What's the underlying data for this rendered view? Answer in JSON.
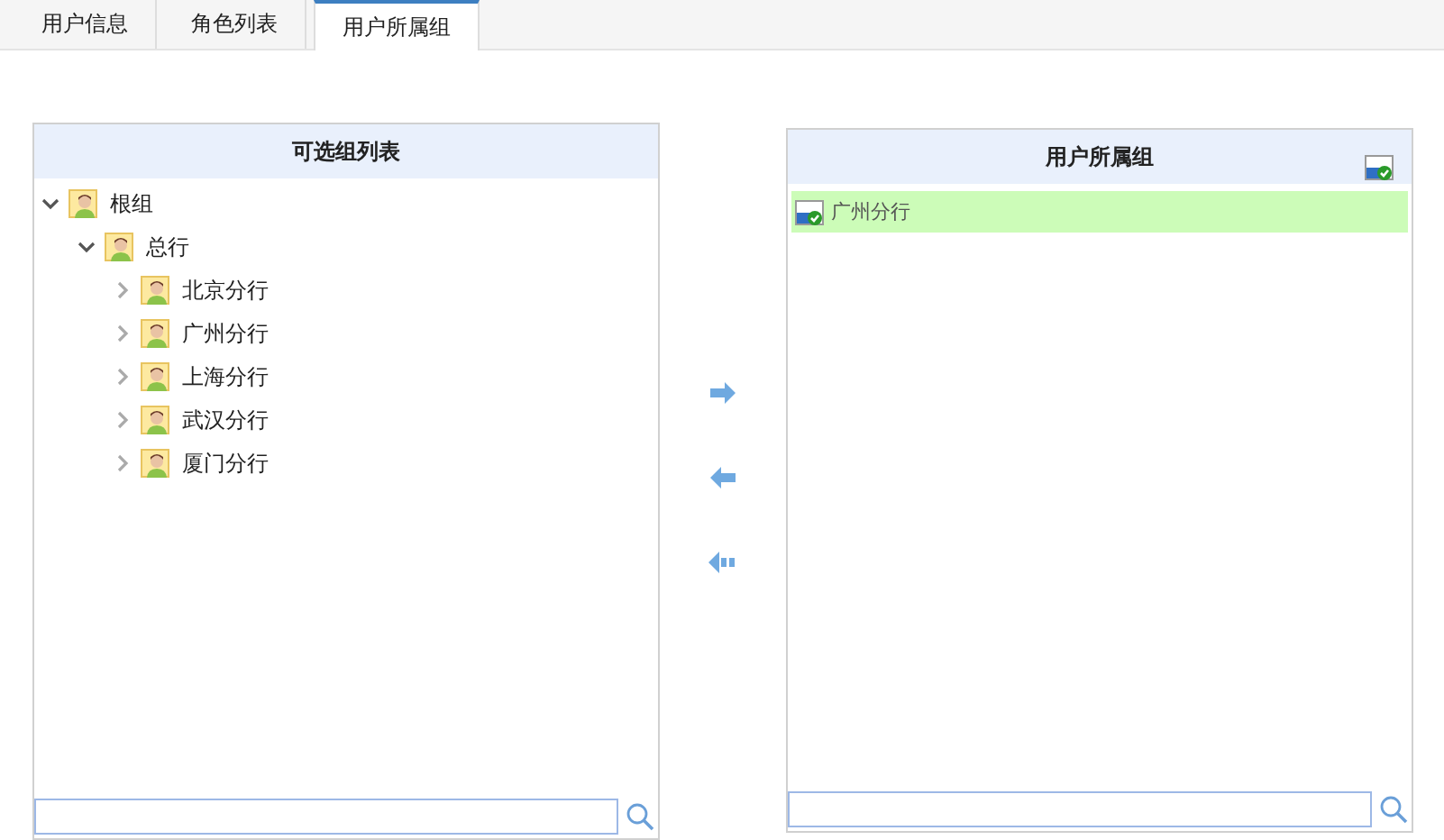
{
  "tabs": [
    {
      "label": "用户信息",
      "selected": false
    },
    {
      "label": "角色列表",
      "selected": false
    },
    {
      "label": "用户所属组",
      "selected": true
    }
  ],
  "available_groups": {
    "title": "可选组列表",
    "tree": [
      {
        "label": "根组",
        "expanded": true,
        "children": [
          {
            "label": "总行",
            "expanded": true,
            "children": [
              {
                "label": "北京分行",
                "expanded": false
              },
              {
                "label": "广州分行",
                "expanded": false
              },
              {
                "label": "上海分行",
                "expanded": false
              },
              {
                "label": "武汉分行",
                "expanded": false
              },
              {
                "label": "厦门分行",
                "expanded": false
              }
            ]
          }
        ]
      }
    ]
  },
  "transfer_buttons": [
    {
      "kind": "add"
    },
    {
      "kind": "remove"
    },
    {
      "kind": "remove_all"
    }
  ],
  "user_groups": {
    "title": "用户所属组",
    "items": [
      {
        "label": "广州分行",
        "selected": true
      }
    ]
  }
}
